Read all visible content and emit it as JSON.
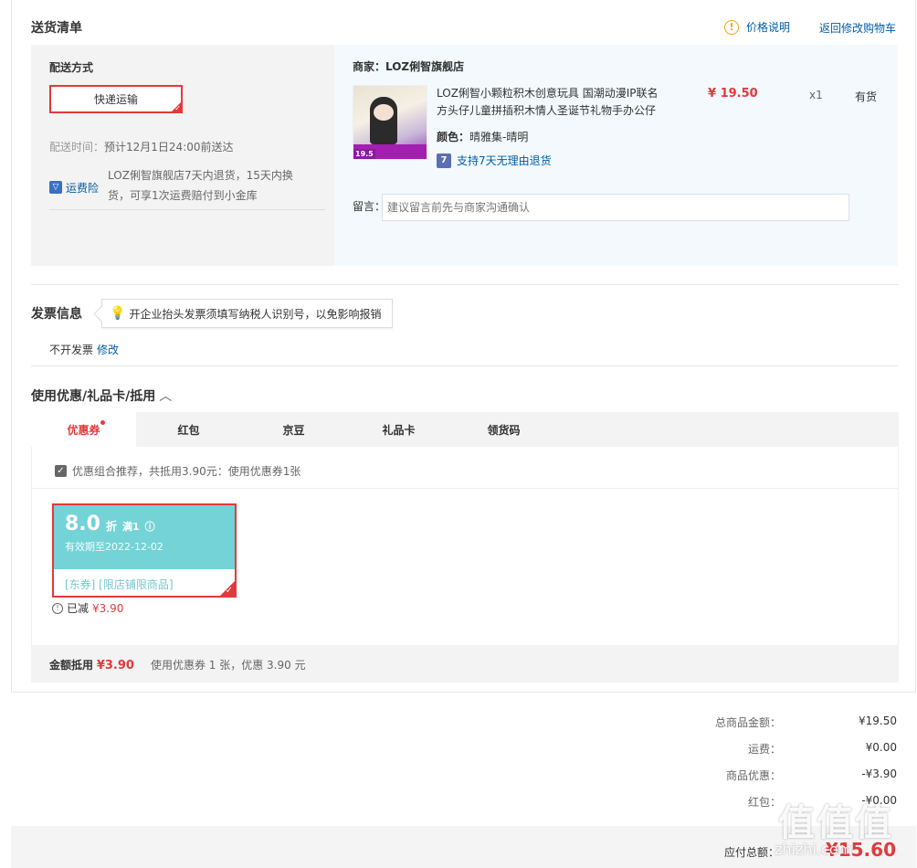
{
  "shipping": {
    "title": "送货清单",
    "price_explain": "价格说明",
    "back_to_cart": "返回修改购物车",
    "delivery_method_label": "配送方式",
    "express_option": "快递运输",
    "delivery_time_label": "配送时间：",
    "delivery_time_value": "预计12月1日24:00前送达",
    "insurance_label": "运费险",
    "insurance_desc": "LOZ俐智旗舰店7天内退货，15天内换货，可享1次运费赔付到小金库"
  },
  "merchant": {
    "name": "商家：LOZ俐智旗舰店",
    "product": {
      "title": "LOZ俐智小颗粒积木创意玩具 国潮动漫IP联名方头仔儿童拼插积木情人圣诞节礼物手办公仔",
      "price": "¥ 19.50",
      "qty": "x1",
      "stock": "有货",
      "color_label": "颜色：",
      "color_value": "晴雅集-晴明",
      "return_policy": "支持7天无理由退货",
      "image_tag": "19.5",
      "return_icon": "7"
    },
    "remark_label": "留言：",
    "remark_placeholder": "建议留言前先与商家沟通确认"
  },
  "invoice": {
    "title": "发票信息",
    "tip": "开企业抬头发票须填写纳税人识别号，以免影响报销",
    "status": "不开发票",
    "edit": "修改"
  },
  "coupons": {
    "title": "使用优惠/礼品卡/抵用",
    "chevron": "︿",
    "tabs": [
      {
        "label": "优惠券",
        "active": true
      },
      {
        "label": "红包",
        "active": false
      },
      {
        "label": "京豆",
        "active": false
      },
      {
        "label": "礼品卡",
        "active": false
      },
      {
        "label": "领货码",
        "active": false
      }
    ],
    "combo_text": "优惠组合推荐，共抵用3.90元：使用优惠券1张",
    "card": {
      "rate": "8.0",
      "unit": "折",
      "condition": "满1",
      "valid": "有效期至2022-12-02",
      "tags": "[东券] [限店铺限商品]"
    },
    "reduced_label": "已减",
    "reduced_amount": "¥3.90",
    "summary_label": "金额抵用",
    "summary_amount": "¥3.90",
    "summary_desc": "使用优惠券 1 张，优惠 3.90 元"
  },
  "totals": {
    "rows": [
      {
        "label": "总商品金额：",
        "value": "¥19.50"
      },
      {
        "label": "运费：",
        "value": "¥0.00"
      },
      {
        "label": "商品优惠：",
        "value": "-¥3.90"
      },
      {
        "label": "红包：",
        "value": "-¥0.00"
      }
    ],
    "pay_label": "应付总额：",
    "pay_amount": "¥15.60"
  },
  "watermark": {
    "main": "值值值",
    "sub": "zhizhi.com"
  },
  "colors": {
    "accent_red": "#e4393c",
    "link_blue": "#005ea7",
    "coupon_teal": "#74d3d6",
    "merchant_bg": "#f3f9fd"
  }
}
